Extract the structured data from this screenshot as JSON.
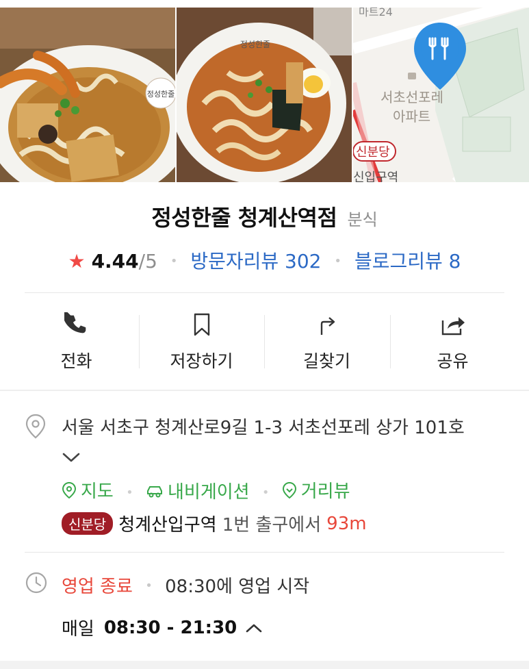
{
  "photos": [
    {
      "alt": "udon-with-fried-shrimp",
      "logo_text": "정성한줄"
    },
    {
      "alt": "spicy-udon-with-egg",
      "logo_text": "정성한줄"
    }
  ],
  "map": {
    "labels": {
      "top": "마트24",
      "building_1": "서초선포레",
      "building_2": "아파트",
      "badge": "신분당",
      "station": "신입구역"
    },
    "marker_icon": "restaurant-fork-knife-icon",
    "marker_color": "#2f8ee0"
  },
  "place": {
    "name": "정성한줄 청계산역점",
    "category": "분식",
    "rating": "4.44",
    "rating_max": "/5",
    "visitor_reviews": "방문자리뷰 302",
    "blog_reviews": "블로그리뷰 8"
  },
  "actions": [
    {
      "label": "전화",
      "icon": "phone-icon"
    },
    {
      "label": "저장하기",
      "icon": "bookmark-icon"
    },
    {
      "label": "길찾기",
      "icon": "directions-icon"
    },
    {
      "label": "공유",
      "icon": "share-icon"
    }
  ],
  "address": {
    "text": "서울 서초구 청계산로9길 1-3 서초선포레 상가 101호"
  },
  "links": {
    "map": "지도",
    "navigation": "내비게이션",
    "street_view": "거리뷰"
  },
  "subway": {
    "line_badge": "신분당",
    "station": "청계산입구역",
    "exit": "1번 출구에서",
    "distance": "93m"
  },
  "hours": {
    "status": "영업 종료",
    "next": "08:30에 영업 시작",
    "days": "매일",
    "time": "08:30 - 21:30"
  },
  "colors": {
    "rating_star": "#f04a46",
    "review_link": "#2b69c5",
    "link_green": "#38a84a",
    "closed_red": "#e8473a",
    "line_badge": "#a01d26"
  }
}
